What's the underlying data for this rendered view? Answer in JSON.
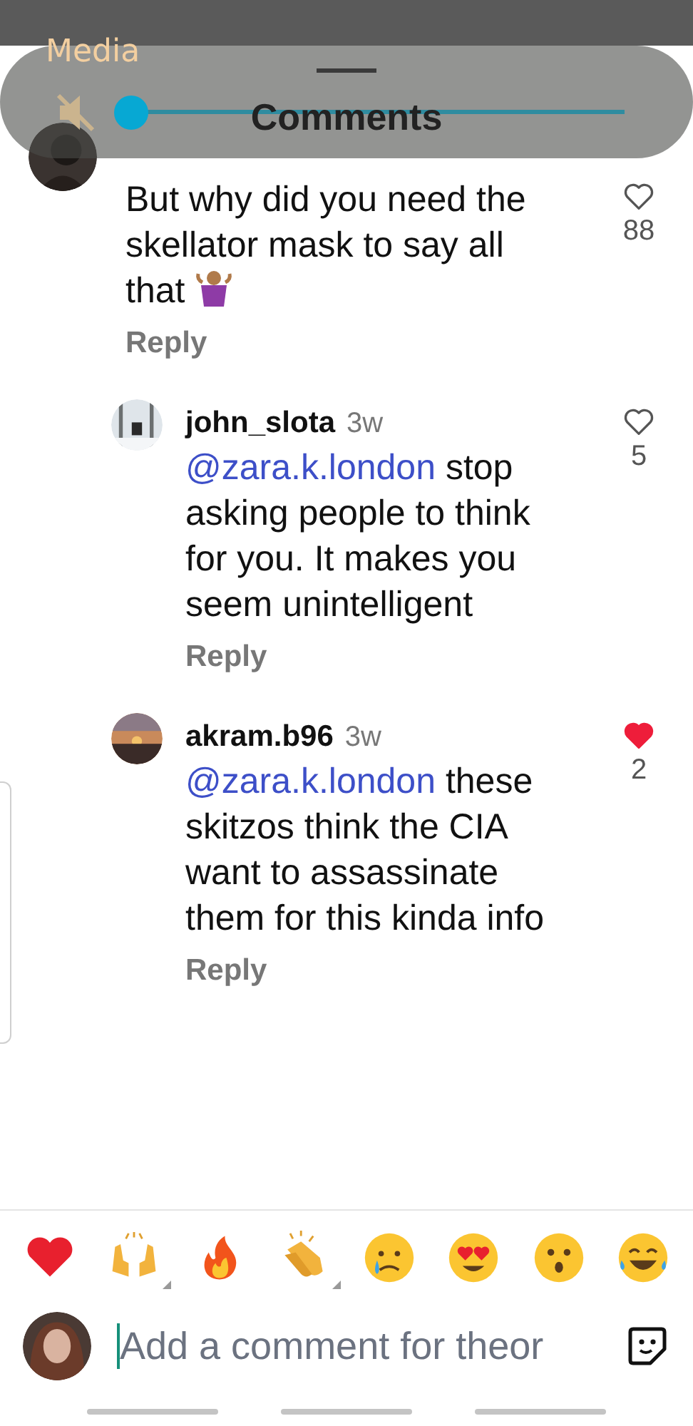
{
  "volume_panel": {
    "title": "Media",
    "muted": true,
    "level": 0
  },
  "header": {
    "title": "Comments"
  },
  "comments": [
    {
      "text": "But why did you need the skellator mask to say all that",
      "likes": "88",
      "liked": false,
      "reply": "Reply"
    },
    {
      "user": "john_slota",
      "time": "3w",
      "mention": "@zara.k.london",
      "text": "stop asking people to think for you. It makes you seem unintelligent",
      "likes": "5",
      "liked": false,
      "reply": "Reply"
    },
    {
      "user": "akram.b96",
      "time": "3w",
      "mention": "@zara.k.london",
      "text": "these skitzos think the CIA want to assassinate them for this kinda info",
      "likes": "2",
      "liked": true,
      "reply": "Reply"
    }
  ],
  "reactions": [
    {
      "kind": "heart",
      "variants": false
    },
    {
      "kind": "raised-hands",
      "variants": true
    },
    {
      "kind": "fire",
      "variants": false
    },
    {
      "kind": "clap",
      "variants": true
    },
    {
      "kind": "crying",
      "variants": false
    },
    {
      "kind": "heart-eyes",
      "variants": false
    },
    {
      "kind": "surprised",
      "variants": false
    },
    {
      "kind": "laughing",
      "variants": false
    }
  ],
  "composer": {
    "placeholder": "Add a comment for theor"
  }
}
